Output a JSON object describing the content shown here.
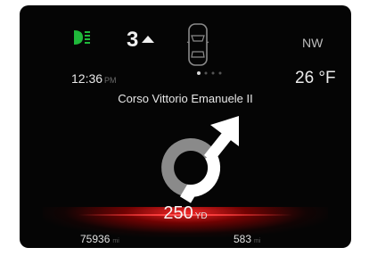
{
  "status": {
    "headlight_icon": "headlight-on-icon",
    "headlight_color": "#1fb83a",
    "gear": "3",
    "compass": "NW",
    "time": "12:36",
    "time_suffix": "PM",
    "temperature": "26 °F"
  },
  "navigation": {
    "street": "Corso Vittorio Emanuele II",
    "maneuver_icon": "roundabout-exit-icon",
    "distance": "250",
    "distance_unit": "YD",
    "page_indicator_count": 4,
    "page_indicator_active": 1
  },
  "trip": {
    "odometer": "75936",
    "odometer_unit": "mi",
    "range": "583",
    "range_unit": "mi"
  },
  "colors": {
    "background": "#050505",
    "accent_glow": "#ff2a2a",
    "arc_gray": "#8a8a8a"
  }
}
